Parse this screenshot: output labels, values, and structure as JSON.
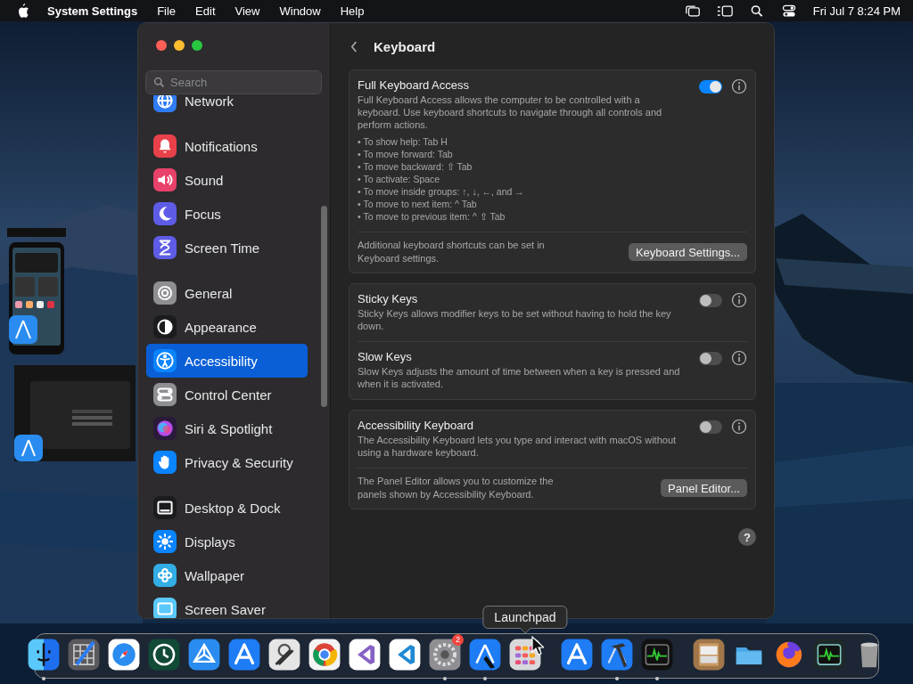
{
  "menu_bar": {
    "app_name": "System Settings",
    "menus": [
      "File",
      "Edit",
      "View",
      "Window",
      "Help"
    ],
    "clock": "Fri Jul 7  8:24 PM"
  },
  "window": {
    "sidebar": {
      "search": {
        "placeholder": "Search"
      },
      "groups": [
        [
          {
            "label": "Network",
            "selected": false
          }
        ],
        [
          {
            "label": "Notifications",
            "selected": false
          },
          {
            "label": "Sound",
            "selected": false
          },
          {
            "label": "Focus",
            "selected": false
          },
          {
            "label": "Screen Time",
            "selected": false
          }
        ],
        [
          {
            "label": "General",
            "selected": false
          },
          {
            "label": "Appearance",
            "selected": false
          },
          {
            "label": "Accessibility",
            "selected": true
          },
          {
            "label": "Control Center",
            "selected": false
          },
          {
            "label": "Siri & Spotlight",
            "selected": false
          },
          {
            "label": "Privacy & Security",
            "selected": false
          }
        ],
        [
          {
            "label": "Desktop & Dock",
            "selected": false
          },
          {
            "label": "Displays",
            "selected": false
          },
          {
            "label": "Wallpaper",
            "selected": false
          },
          {
            "label": "Screen Saver",
            "selected": false
          }
        ]
      ]
    },
    "title": "Keyboard",
    "sections": [
      {
        "rows": [
          {
            "kind": "setting",
            "title": "Full Keyboard Access",
            "description": "Full Keyboard Access allows the computer to be controlled with a keyboard. Use keyboard shortcuts to navigate through all controls and perform actions.",
            "on": true,
            "bullets": [
              "• To show help: Tab H",
              "• To move forward: Tab",
              "• To move backward: ⇧ Tab",
              "• To activate: Space",
              "• To move inside groups: ↑, ↓, ←, and →",
              "• To move to next item: ^ Tab",
              "• To move to previous item: ^ ⇧ Tab"
            ]
          },
          {
            "kind": "action",
            "text": "Additional keyboard shortcuts can be set in Keyboard settings.",
            "button": "Keyboard Settings..."
          }
        ]
      },
      {
        "rows": [
          {
            "kind": "setting",
            "title": "Sticky Keys",
            "description": "Sticky Keys allows modifier keys to be set without having to hold the key down.",
            "on": false
          },
          {
            "kind": "setting",
            "title": "Slow Keys",
            "description": "Slow Keys adjusts the amount of time between when a key is pressed and when it is activated.",
            "on": false
          }
        ]
      },
      {
        "rows": [
          {
            "kind": "setting",
            "title": "Accessibility Keyboard",
            "description": "The Accessibility Keyboard lets you type and interact with macOS without using a hardware keyboard.",
            "on": false
          },
          {
            "kind": "action",
            "text": "The Panel Editor allows you to customize the panels shown by Accessibility Keyboard.",
            "button": "Panel Editor..."
          }
        ]
      }
    ],
    "help": "?"
  },
  "dock": {
    "tooltip": "Launchpad",
    "groups": [
      [
        {
          "running": true
        },
        {
          "running": false
        },
        {
          "running": false
        },
        {
          "running": false
        },
        {
          "running": false
        },
        {
          "running": false
        },
        {
          "running": false
        },
        {
          "running": false
        },
        {
          "running": false
        },
        {
          "running": false
        },
        {
          "running": true,
          "badge": "2"
        },
        {
          "running": true
        },
        {
          "running": false
        }
      ],
      [
        {
          "running": false
        },
        {
          "running": true
        },
        {
          "running": true
        }
      ],
      [
        {
          "running": false
        },
        {
          "running": false
        },
        {
          "running": false
        },
        {
          "running": false
        },
        {
          "running": false
        }
      ]
    ]
  }
}
